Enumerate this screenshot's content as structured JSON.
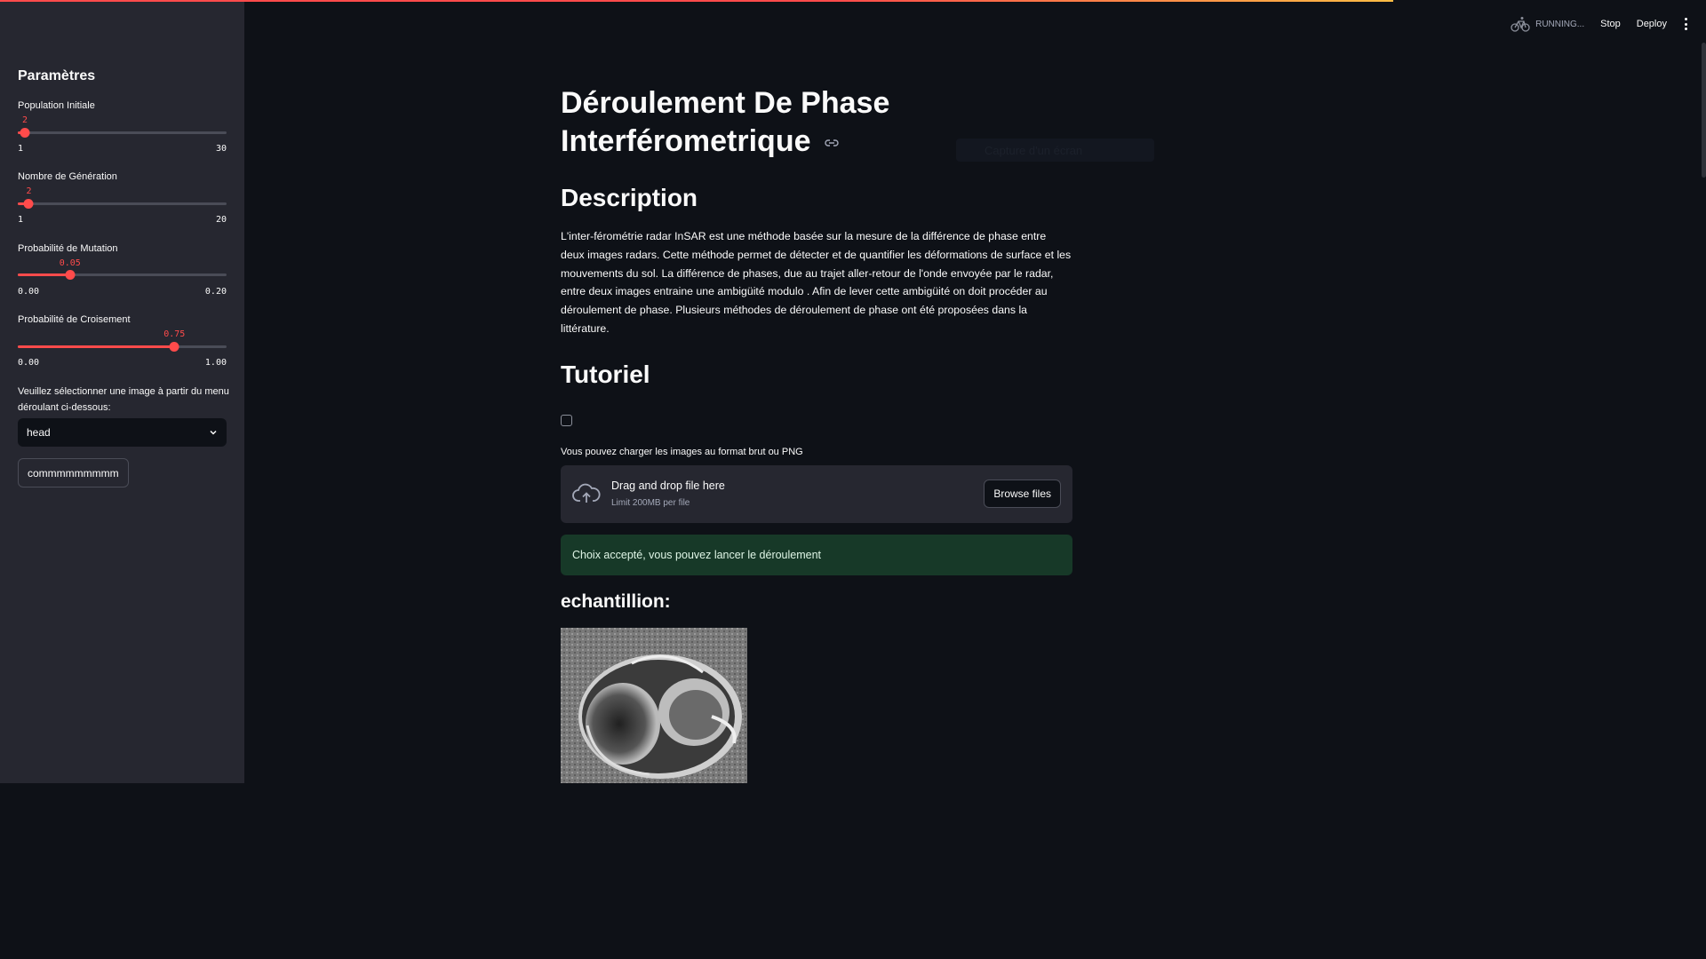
{
  "sidebar": {
    "title": "Paramètres",
    "sliders": [
      {
        "label": "Population Initiale",
        "value": "2",
        "min": "1",
        "max": "30",
        "fraction": 0.034
      },
      {
        "label": "Nombre de Génération",
        "value": "2",
        "min": "1",
        "max": "20",
        "fraction": 0.053
      },
      {
        "label": "Probabilité de Mutation",
        "value": "0.05",
        "min": "0.00",
        "max": "0.20",
        "fraction": 0.25
      },
      {
        "label": "Probabilité de Croisement",
        "value": "0.75",
        "min": "0.00",
        "max": "1.00",
        "fraction": 0.75
      }
    ],
    "select_label": "Veuillez sélectionner une image à partir du menu déroulant ci-dessous:",
    "select_value": "head",
    "button_label": "commmmmmmmm"
  },
  "header": {
    "running": "RUNNING...",
    "stop": "Stop",
    "deploy": "Deploy"
  },
  "main": {
    "title": "Déroulement De Phase Interférometrique",
    "ghost_text": "Capture d'un écran",
    "description_heading": "Description",
    "description": "L'inter-férométrie radar InSAR est une méthode basée sur la mesure de la différence de phase entre deux images radars. Cette méthode permet de détecter et de quantifier les déformations de surface et les mouvements du sol. La différence de phases, due au trajet aller-retour de l'onde envoyée par le radar, entre deux images entraine une ambigüité modulo . Afin de lever cette ambigüité on doit procéder au déroulement de phase. Plusieurs méthodes de déroulement de phase ont été proposées dans la littérature.",
    "tutorial_heading": "Tutoriel",
    "upload_label": "Vous pouvez charger les images au format brut ou PNG",
    "dropzone_title": "Drag and drop file here",
    "dropzone_sub": "Limit 200MB per file",
    "browse_label": "Browse files",
    "success_message": "Choix accepté, vous pouvez lancer le déroulement",
    "sample_heading": "echantillion:"
  },
  "colors": {
    "accent": "#ff4b4b",
    "background": "#0e1117",
    "sidebar": "#262730",
    "success_bg": "#173928"
  }
}
